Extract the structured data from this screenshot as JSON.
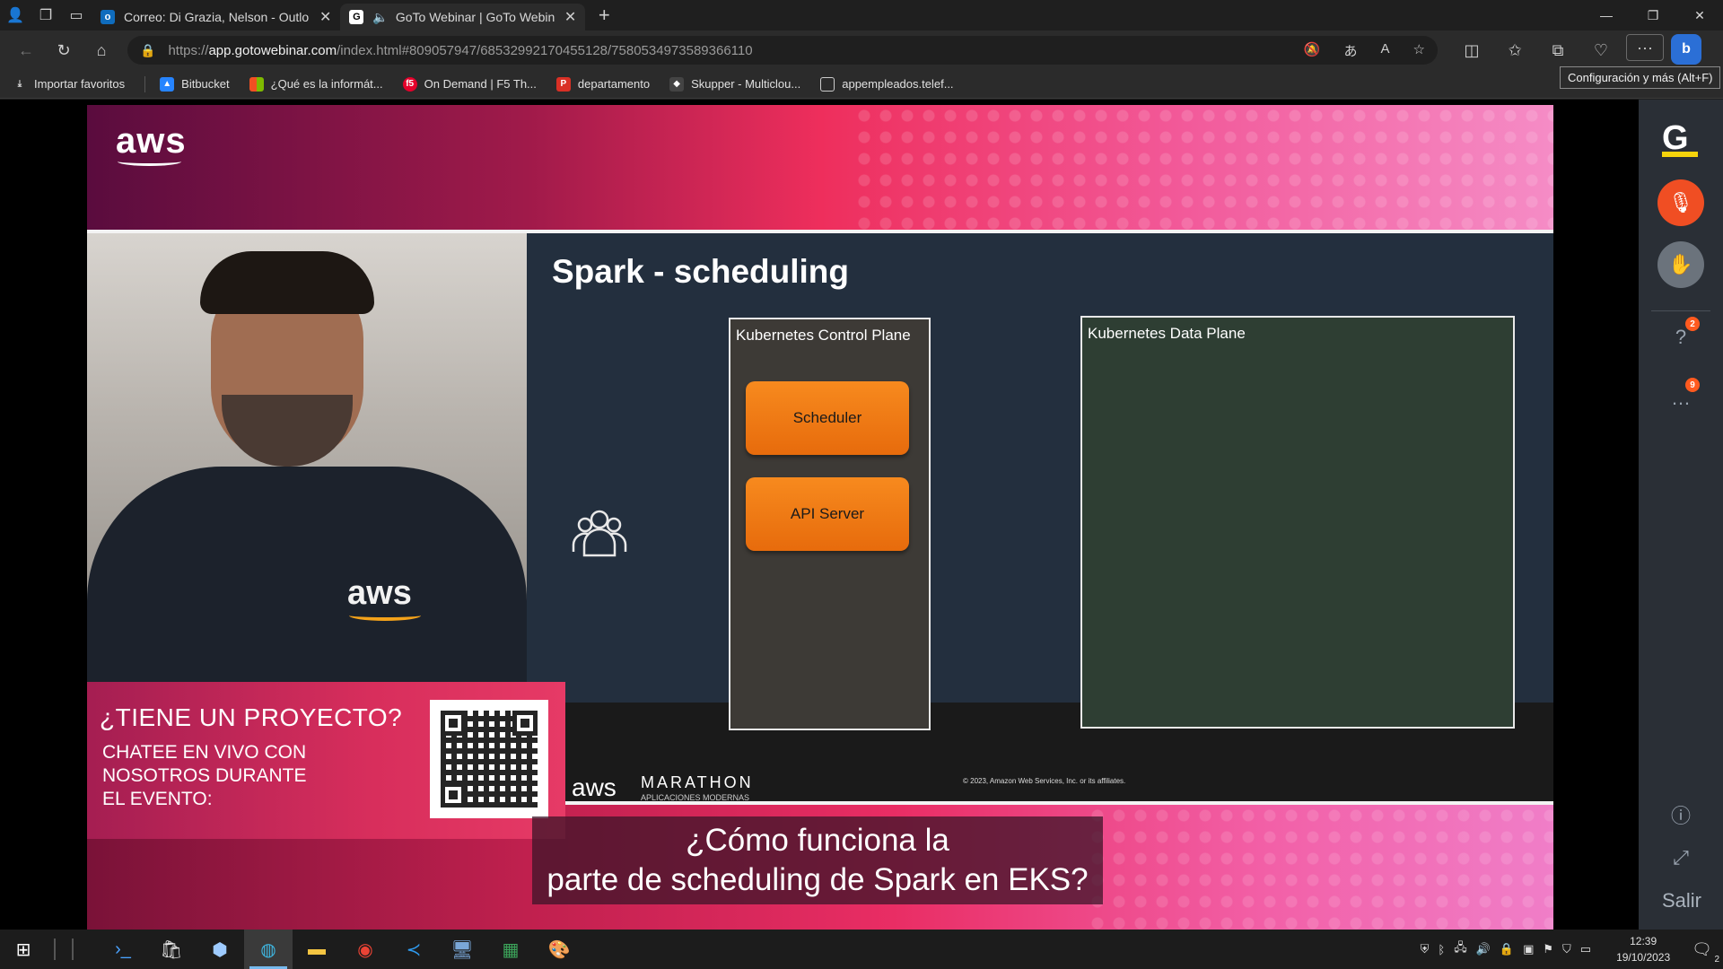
{
  "browser": {
    "tabs": [
      {
        "title": "Correo: Di Grazia, Nelson - Outlo",
        "icon": "outlook-icon",
        "active": false
      },
      {
        "title": "GoTo Webinar | GoTo Webin",
        "icon": "goto-icon",
        "active": true
      }
    ],
    "url": {
      "prefix": "https://",
      "host": "app.gotowebinar.com",
      "rest": "/index.html#809057947/6853299217045512­8/7580534973589366110"
    },
    "tooltip": "Configuración y más (Alt+F)",
    "favorites": [
      {
        "label": "Importar favoritos",
        "icon": "import-icon"
      },
      {
        "label": "Bitbucket",
        "icon": "bitbucket-icon"
      },
      {
        "label": "¿Qué es la informát...",
        "icon": "microsoft-icon"
      },
      {
        "label": "On Demand | F5 Th...",
        "icon": "f5-icon"
      },
      {
        "label": "departamento",
        "icon": "pdf-icon"
      },
      {
        "label": "Skupper - Multiclou...",
        "icon": "skupper-icon"
      },
      {
        "label": "appempleados.telef...",
        "icon": "page-icon"
      }
    ]
  },
  "video": {
    "aws_logo": "aws",
    "slide_title": "Spark - scheduling",
    "control_plane_label": "Kubernetes Control Plane",
    "data_plane_label": "Kubernetes Data Plane",
    "scheduler_label": "Scheduler",
    "api_server_label": "API Server",
    "marathon_aws": "aws",
    "marathon_title": "MARATHON",
    "marathon_subtitle": "APLICACIONES MODERNAS",
    "copyright": "© 2023, Amazon Web Services, Inc. or its affiliates.",
    "promo_title": "¿TIENE UN PROYECTO?",
    "promo_line1": "CHATEE EN VIVO CON",
    "promo_line2": "NOSOTROS DURANTE",
    "promo_line3": "EL EVENTO:",
    "shirt_logo": "aws",
    "subtitle_line1": "¿Cómo funciona la",
    "subtitle_line2": "parte de scheduling de Spark en EKS?"
  },
  "rail": {
    "logo": "G",
    "questions_badge": "2",
    "chat_badge": "9",
    "exit_label": "Salir"
  },
  "taskbar": {
    "time": "12:39",
    "date": "19/10/2023",
    "notifications": "2"
  }
}
